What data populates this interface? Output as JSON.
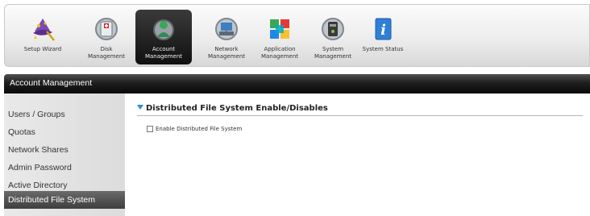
{
  "toolbar": {
    "items": [
      {
        "label": "Setup Wizard",
        "icon": "wizard-icon"
      },
      {
        "label": "Disk\nManagement",
        "icon": "disk-icon"
      },
      {
        "label": "Account\nManagement",
        "icon": "account-icon",
        "active": true
      },
      {
        "label": "Network\nManagement",
        "icon": "network-icon"
      },
      {
        "label": "Application\nManagement",
        "icon": "application-icon"
      },
      {
        "label": "System\nManagement",
        "icon": "system-icon"
      },
      {
        "label": "System Status",
        "icon": "info-icon"
      }
    ]
  },
  "section": {
    "title": "Account Management"
  },
  "sidebar": {
    "items": [
      {
        "label": "Users / Groups"
      },
      {
        "label": "Quotas"
      },
      {
        "label": "Network Shares"
      },
      {
        "label": "Admin Password"
      },
      {
        "label": "Active Directory"
      },
      {
        "label": "Distributed File System",
        "active": true
      }
    ]
  },
  "main": {
    "heading": "Distributed File System Enable/Disables",
    "checkbox_label": "Enable Distributed File System",
    "checkbox_checked": false
  },
  "colors": {
    "accent_triangle": "#2a8fd8",
    "header_bar": "#1e1e1e",
    "active_menu": "#4a4a4a"
  }
}
